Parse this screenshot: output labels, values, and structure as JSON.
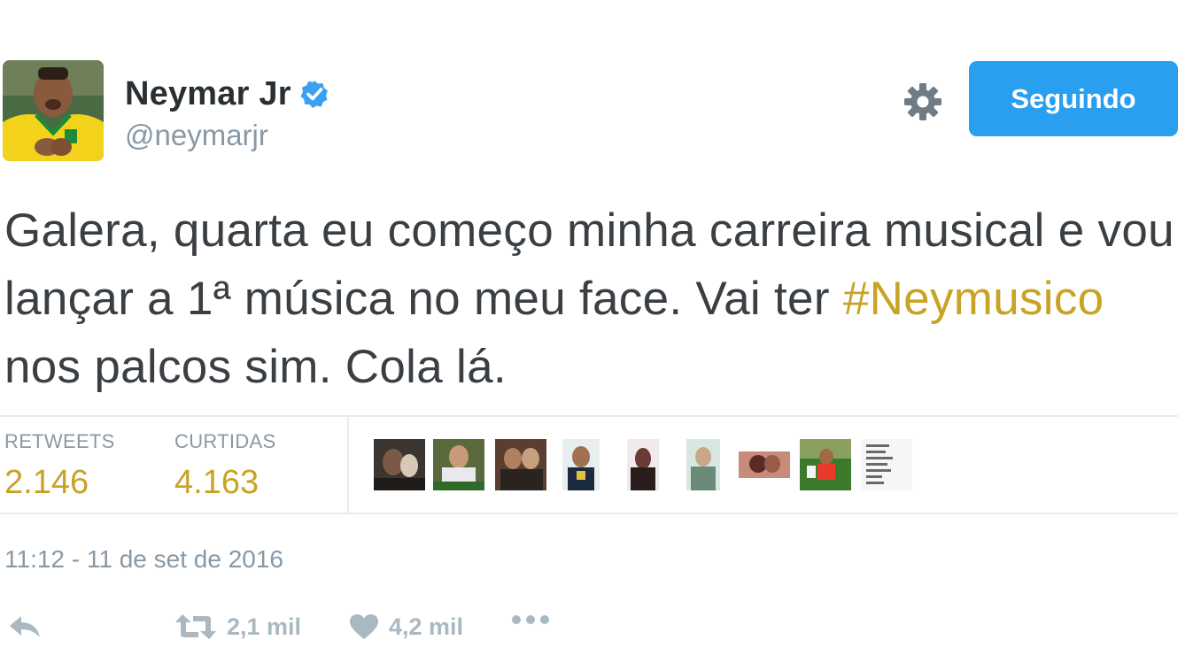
{
  "user": {
    "display_name": "Neymar Jr",
    "handle": "@neymarjr",
    "verified": true
  },
  "header": {
    "follow_button_label": "Seguindo",
    "settings_icon": "gear-icon"
  },
  "tweet": {
    "text_parts": [
      "Galera, quarta eu começo minha carreira musical e vou lançar a 1ª música no meu face. Vai ter ",
      "#Neymusico",
      " nos palcos sim. Cola lá."
    ]
  },
  "stats": {
    "retweets_label": "RETWEETS",
    "retweets_value": "2.146",
    "likes_label": "CURTIDAS",
    "likes_value": "4.163"
  },
  "timestamp": "11:12 - 11 de set de 2016",
  "actions": {
    "reply_icon": "reply-icon",
    "retweet_count": "2,1 mil",
    "like_count": "4,2 mil",
    "more_icon": "more-icon"
  },
  "colors": {
    "accent_blue": "#2a9ff0",
    "hashtag_gold": "#c9a325",
    "muted": "#8899a6",
    "text": "#3a3f44"
  }
}
